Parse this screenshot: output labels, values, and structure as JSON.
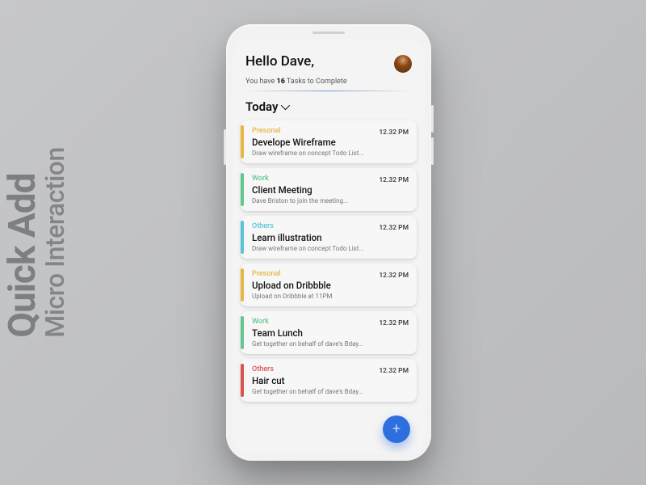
{
  "background": {
    "line1": "Quick Add",
    "line2": "Micro Interaction"
  },
  "header": {
    "greeting": "Hello Dave,",
    "summary_prefix": "You have ",
    "task_count": "16",
    "summary_suffix": " Tasks to Complete"
  },
  "filter": {
    "label": "Today"
  },
  "categories": {
    "personal": "Presonal",
    "work": "Work",
    "others": "Others"
  },
  "tasks": [
    {
      "category": "personal",
      "title": "Develope Wireframe",
      "desc": "Draw wireframe on concept Todo List...",
      "time": "12.32 PM"
    },
    {
      "category": "work",
      "title": "Client Meeting",
      "desc": "Dave Briston to join the meeting...",
      "time": "12.32 PM"
    },
    {
      "category": "others_a",
      "title": "Learn illustration",
      "desc": "Draw wireframe on concept Todo List...",
      "time": "12.32 PM"
    },
    {
      "category": "personal",
      "title": "Upload on Dribbble",
      "desc": "Upload on Dribbble at 11PM",
      "time": "12.32 PM"
    },
    {
      "category": "work",
      "title": "Team Lunch",
      "desc": "Get together on behalf of dave's Bday...",
      "time": "12.32 PM"
    },
    {
      "category": "others_b",
      "title": "Hair cut",
      "desc": "Get together on behalf of dave's Bday...",
      "time": "12.32 PM"
    }
  ],
  "fab": {
    "glyph": "+"
  },
  "colors": {
    "accent": "#2e6fe0",
    "personal": "#e6b843",
    "work": "#63c68f",
    "others_a": "#5bc4d6",
    "others_b": "#d9534f"
  }
}
